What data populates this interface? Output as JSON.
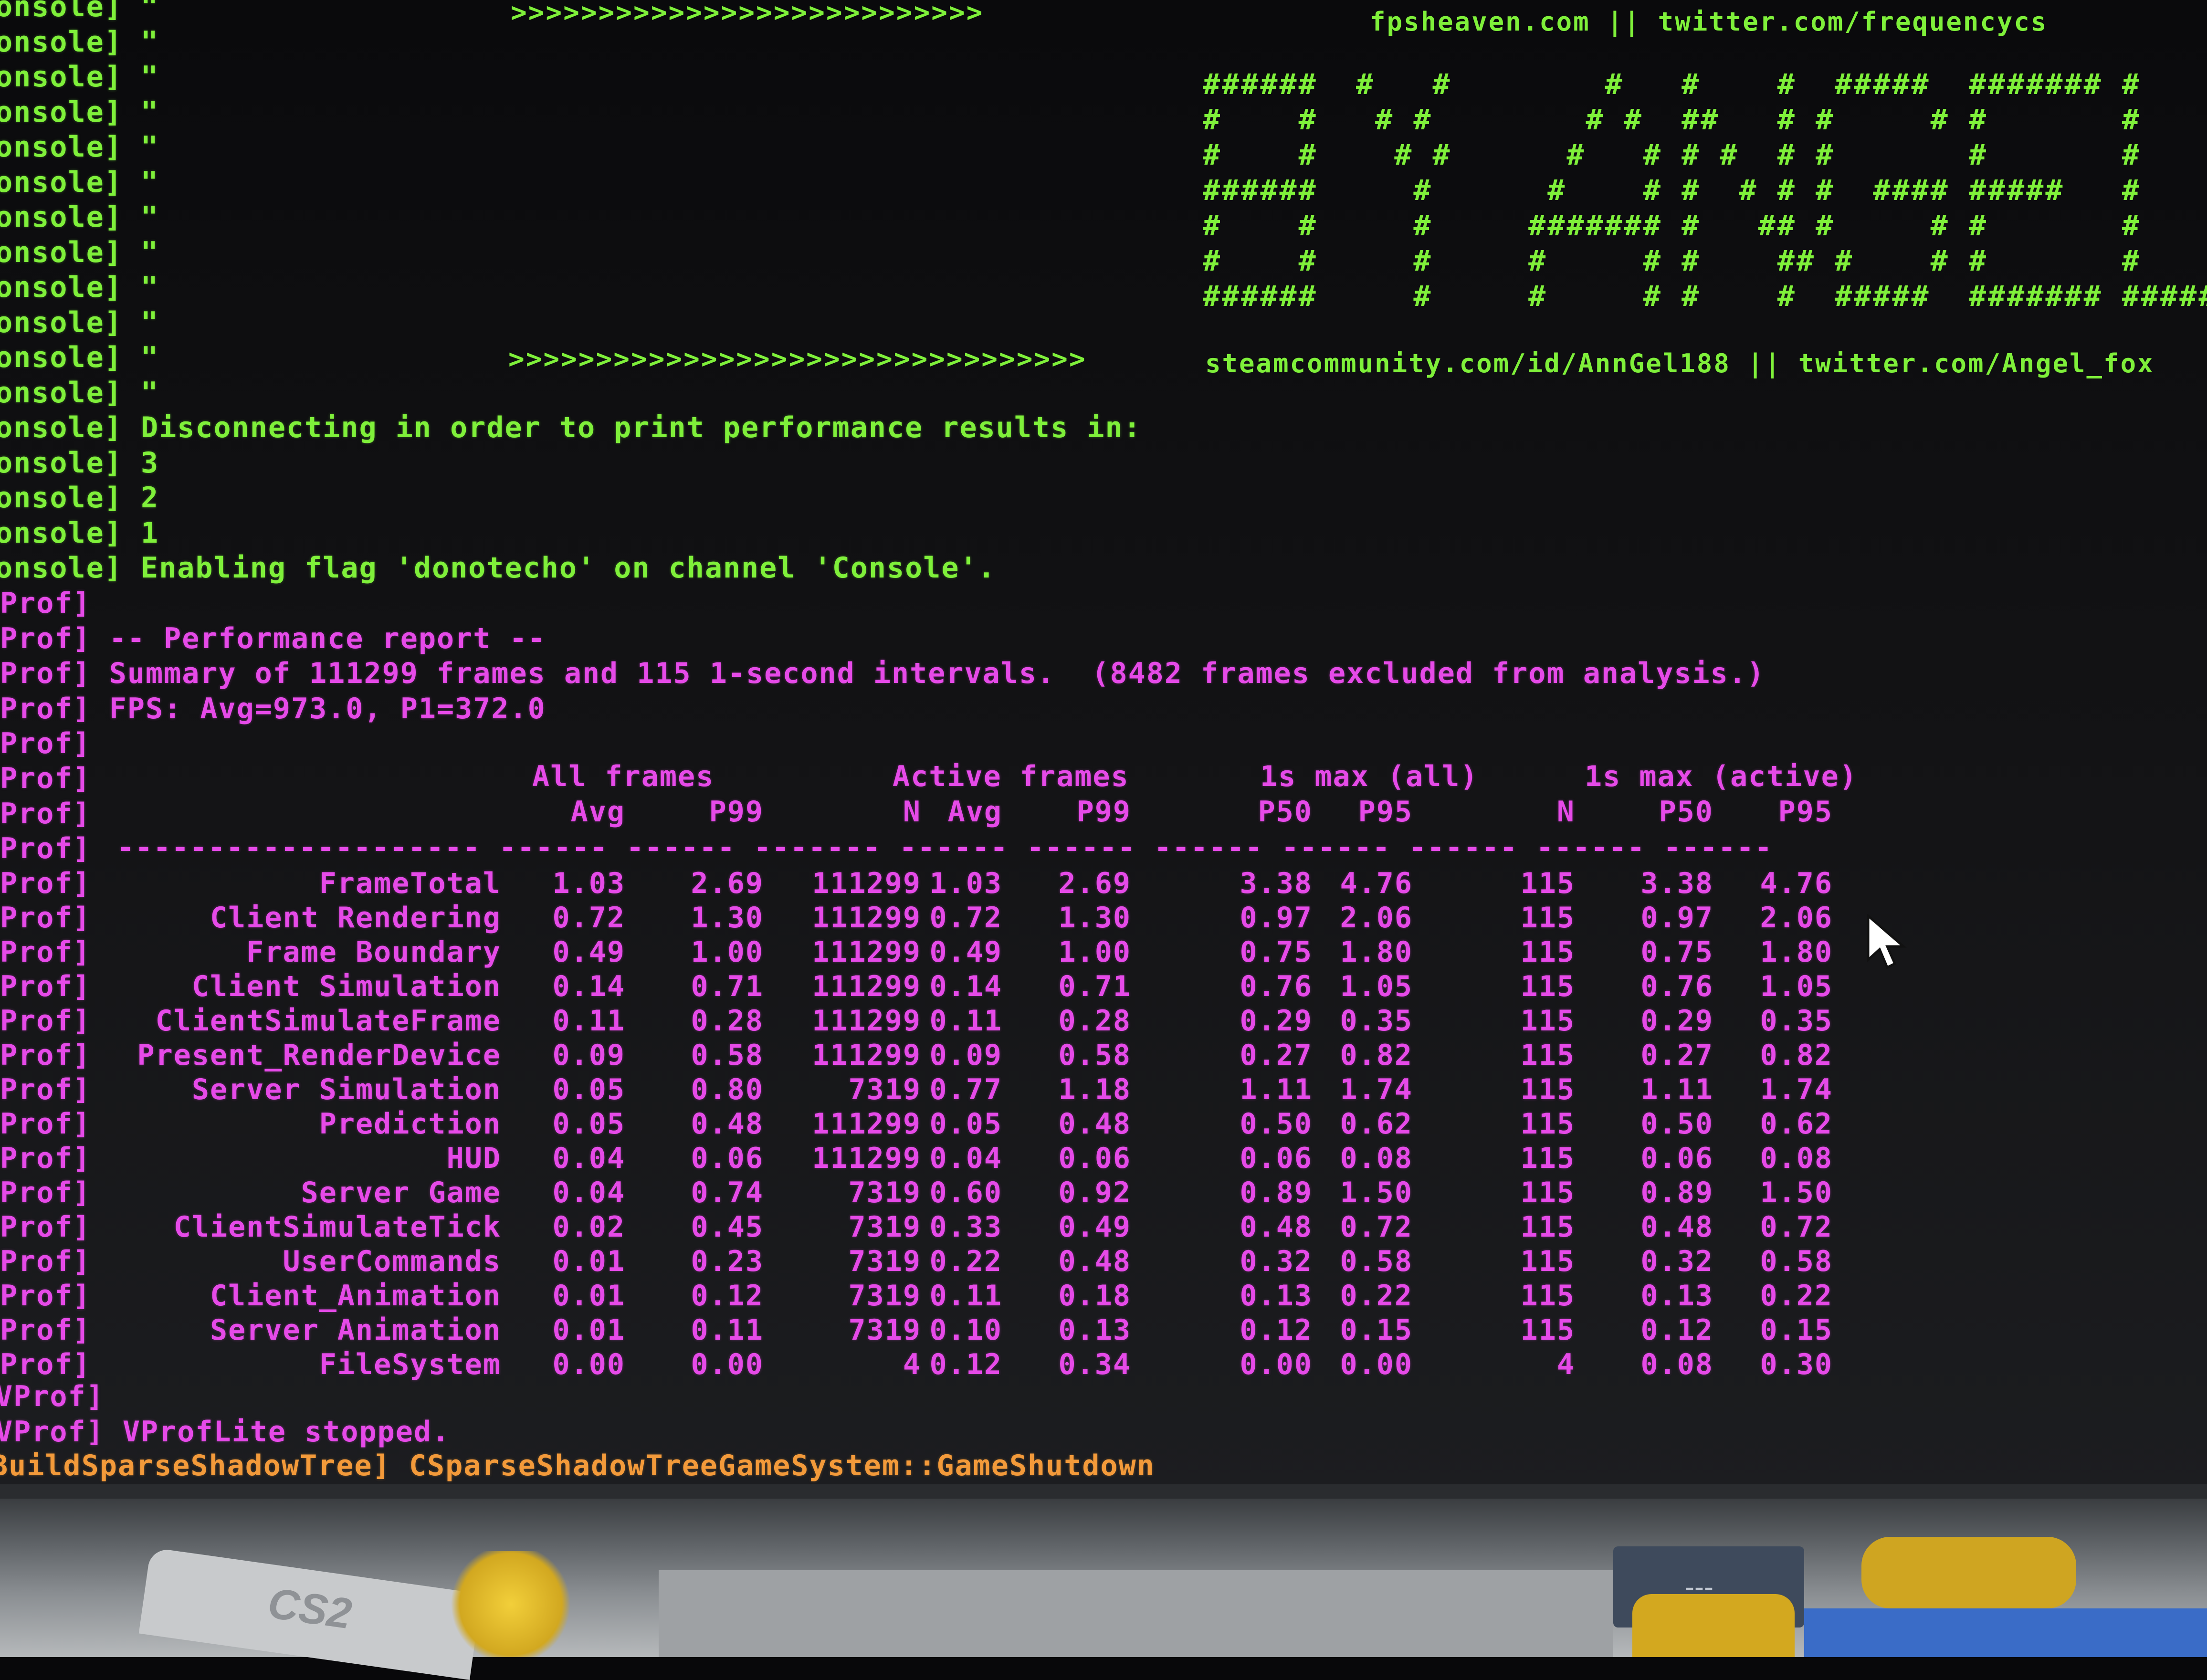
{
  "header": {
    "arrow_top": ">>>>>>>>>>>>>>>>>>>>>>>>>>>",
    "link_top": "fpsheaven.com || twitter.com/frequencycs",
    "arrow_bottom": ">>>>>>>>>>>>>>>>>>>>>>>>>>>>>>>>>",
    "link_bottom": "steamcommunity.com/id/AnnGel188 || twitter.com/Angel_fox",
    "ascii_art": [
      "######  #   #        #   #    #  #####  ####### #",
      "#    #   # #        # #  ##   # #     # #       #",
      "#    #    # #      #   # # #  # #       #       #",
      "######     #      #    # #  # # #  #### #####   #",
      "#    #     #     ####### #   ## #     # #       #",
      "#    #     #     #     # #    ## #    # #       #",
      "######     #     #     # #    #  #####  ####### #####"
    ]
  },
  "console_lines": [
    {
      "prefix": "onsole]",
      "text": " \""
    },
    {
      "prefix": "onsole]",
      "text": " \""
    },
    {
      "prefix": "onsole]",
      "text": " \""
    },
    {
      "prefix": "onsole]",
      "text": " \""
    },
    {
      "prefix": "onsole]",
      "text": " \""
    },
    {
      "prefix": "onsole]",
      "text": " \""
    },
    {
      "prefix": "onsole]",
      "text": " \""
    },
    {
      "prefix": "onsole]",
      "text": " \""
    },
    {
      "prefix": "onsole]",
      "text": " \""
    },
    {
      "prefix": "onsole]",
      "text": " \""
    },
    {
      "prefix": "onsole]",
      "text": " \""
    },
    {
      "prefix": "onsole]",
      "text": " \""
    },
    {
      "prefix": "onsole]",
      "text": " Disconnecting in order to print performance results in:"
    },
    {
      "prefix": "onsole]",
      "text": " 3"
    },
    {
      "prefix": "onsole]",
      "text": " 2"
    },
    {
      "prefix": "onsole]",
      "text": " 1"
    },
    {
      "prefix": "onsole]",
      "text": " Enabling flag 'donotecho' on channel 'Console'."
    }
  ],
  "prof_lines": [
    "Prof]",
    "Prof] -- Performance report --",
    "Prof] Summary of 111299 frames and 115 1-second intervals.  (8482 frames excluded from analysis.)",
    "Prof] FPS: Avg=973.0, P1=372.0",
    "Prof]"
  ],
  "table": {
    "group_headers": [
      "All frames",
      "Active frames",
      "1s max (all)",
      "1s max (active)"
    ],
    "col_headers": [
      "Avg",
      "P99",
      "N",
      "Avg",
      "P99",
      "P50",
      "P95",
      "N",
      "P50",
      "P95"
    ],
    "divider": "-------------------- ------ ------ ------- ------ ------ ------ ------ ------ ------ ------",
    "row_prefix": "Prof]",
    "rows": [
      {
        "name": "FrameTotal",
        "v": [
          "1.03",
          "2.69",
          "111299",
          "1.03",
          "2.69",
          "3.38",
          "4.76",
          "115",
          "3.38",
          "4.76"
        ]
      },
      {
        "name": "Client Rendering",
        "v": [
          "0.72",
          "1.30",
          "111299",
          "0.72",
          "1.30",
          "0.97",
          "2.06",
          "115",
          "0.97",
          "2.06"
        ]
      },
      {
        "name": "Frame Boundary",
        "v": [
          "0.49",
          "1.00",
          "111299",
          "0.49",
          "1.00",
          "0.75",
          "1.80",
          "115",
          "0.75",
          "1.80"
        ]
      },
      {
        "name": "Client Simulation",
        "v": [
          "0.14",
          "0.71",
          "111299",
          "0.14",
          "0.71",
          "0.76",
          "1.05",
          "115",
          "0.76",
          "1.05"
        ]
      },
      {
        "name": "ClientSimulateFrame",
        "v": [
          "0.11",
          "0.28",
          "111299",
          "0.11",
          "0.28",
          "0.29",
          "0.35",
          "115",
          "0.29",
          "0.35"
        ]
      },
      {
        "name": "Present_RenderDevice",
        "v": [
          "0.09",
          "0.58",
          "111299",
          "0.09",
          "0.58",
          "0.27",
          "0.82",
          "115",
          "0.27",
          "0.82"
        ]
      },
      {
        "name": "Server Simulation",
        "v": [
          "0.05",
          "0.80",
          "7319",
          "0.77",
          "1.18",
          "1.11",
          "1.74",
          "115",
          "1.11",
          "1.74"
        ]
      },
      {
        "name": "Prediction",
        "v": [
          "0.05",
          "0.48",
          "111299",
          "0.05",
          "0.48",
          "0.50",
          "0.62",
          "115",
          "0.50",
          "0.62"
        ]
      },
      {
        "name": "HUD",
        "v": [
          "0.04",
          "0.06",
          "111299",
          "0.04",
          "0.06",
          "0.06",
          "0.08",
          "115",
          "0.06",
          "0.08"
        ]
      },
      {
        "name": "Server Game",
        "v": [
          "0.04",
          "0.74",
          "7319",
          "0.60",
          "0.92",
          "0.89",
          "1.50",
          "115",
          "0.89",
          "1.50"
        ]
      },
      {
        "name": "ClientSimulateTick",
        "v": [
          "0.02",
          "0.45",
          "7319",
          "0.33",
          "0.49",
          "0.48",
          "0.72",
          "115",
          "0.48",
          "0.72"
        ]
      },
      {
        "name": "UserCommands",
        "v": [
          "0.01",
          "0.23",
          "7319",
          "0.22",
          "0.48",
          "0.32",
          "0.58",
          "115",
          "0.32",
          "0.58"
        ]
      },
      {
        "name": "Client_Animation",
        "v": [
          "0.01",
          "0.12",
          "7319",
          "0.11",
          "0.18",
          "0.13",
          "0.22",
          "115",
          "0.13",
          "0.22"
        ]
      },
      {
        "name": "Server Animation",
        "v": [
          "0.01",
          "0.11",
          "7319",
          "0.10",
          "0.13",
          "0.12",
          "0.15",
          "115",
          "0.12",
          "0.15"
        ]
      },
      {
        "name": "FileSystem",
        "v": [
          "0.00",
          "0.00",
          "4",
          "0.12",
          "0.34",
          "0.00",
          "0.00",
          "4",
          "0.08",
          "0.30"
        ]
      }
    ]
  },
  "footer_lines": [
    {
      "prefix": "VProf]",
      "text": ""
    },
    {
      "prefix": "VProf]",
      "text": " VProfLite stopped."
    }
  ],
  "shutdown_line": {
    "prefix": "BuildSparseShadowTree]",
    "text": " CSparseShadowTreeGameSystem::GameShutdown"
  },
  "desk": {
    "logo_text": "CS2",
    "sticker_text": "---"
  },
  "colors": {
    "green": "#7ff03a",
    "magenta": "#e64ae8",
    "orange": "#f39a3a"
  }
}
